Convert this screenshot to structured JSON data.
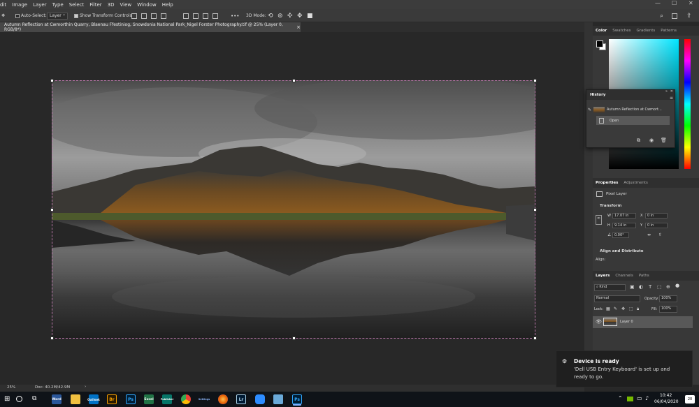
{
  "menu": [
    "dit",
    "Image",
    "Layer",
    "Type",
    "Select",
    "Filter",
    "3D",
    "View",
    "Window",
    "Help"
  ],
  "options": {
    "auto_select_label": "Auto-Select:",
    "target_value": "Layer",
    "transform_controls_label": "Show Transform Controls",
    "more_label": "•••",
    "mode_3d_label": "3D Mode:"
  },
  "document": {
    "tab_title": "Autumn Reflection at Cwmorthin Quarry, Blaenau Ffestiniog, Snowdonia National Park_Nigel Forster Photography.tif @ 25% (Layer 0, RGB/8*)",
    "close": "×"
  },
  "statusbar": {
    "zoom": "25%",
    "doc_info": "Doc: 40.2M/42.9M",
    "arrow": "›"
  },
  "color_panel": {
    "tabs": [
      "Color",
      "Swatches",
      "Gradients",
      "Patterns"
    ],
    "foreground": "#000000",
    "background": "#ffffff"
  },
  "history_panel": {
    "title": "History",
    "snapshot_label": "Autumn Reflection at Cwmort...",
    "steps": [
      "Open"
    ]
  },
  "properties_panel": {
    "tabs": [
      "Properties",
      "Adjustments"
    ],
    "layer_type": "Pixel Layer",
    "transform_title": "Transform",
    "w_label": "W",
    "w_value": "17.07 in",
    "h_label": "H",
    "h_value": "9.14 in",
    "x_label": "X",
    "x_value": "0 in",
    "y_label": "Y",
    "y_value": "0 in",
    "angle_value": "0.00°",
    "align_title": "Align and Distribute",
    "align_label": "Align:"
  },
  "layers_panel": {
    "tabs": [
      "Layers",
      "Channels",
      "Paths"
    ],
    "filter_label": "Kind",
    "blend_mode": "Normal",
    "opacity_label": "Opacity:",
    "opacity_value": "100%",
    "lock_label": "Lock:",
    "fill_label": "Fill:",
    "fill_value": "100%",
    "layers": [
      {
        "name": "Layer 0"
      }
    ]
  },
  "toast": {
    "title": "Device is ready",
    "line1": "'Dell USB Entry Keyboard' is set up and",
    "line2": "ready to go."
  },
  "taskbar": {
    "apps": [
      "Word",
      "Outlook",
      "Br",
      "Ps",
      "Excel",
      "Publisher",
      "Chrome",
      "Settings",
      "Firefox",
      "Lr",
      "Zoom",
      "App",
      "Ps"
    ],
    "time": "10:42",
    "date": "06/04/2020",
    "notifications": "20"
  }
}
